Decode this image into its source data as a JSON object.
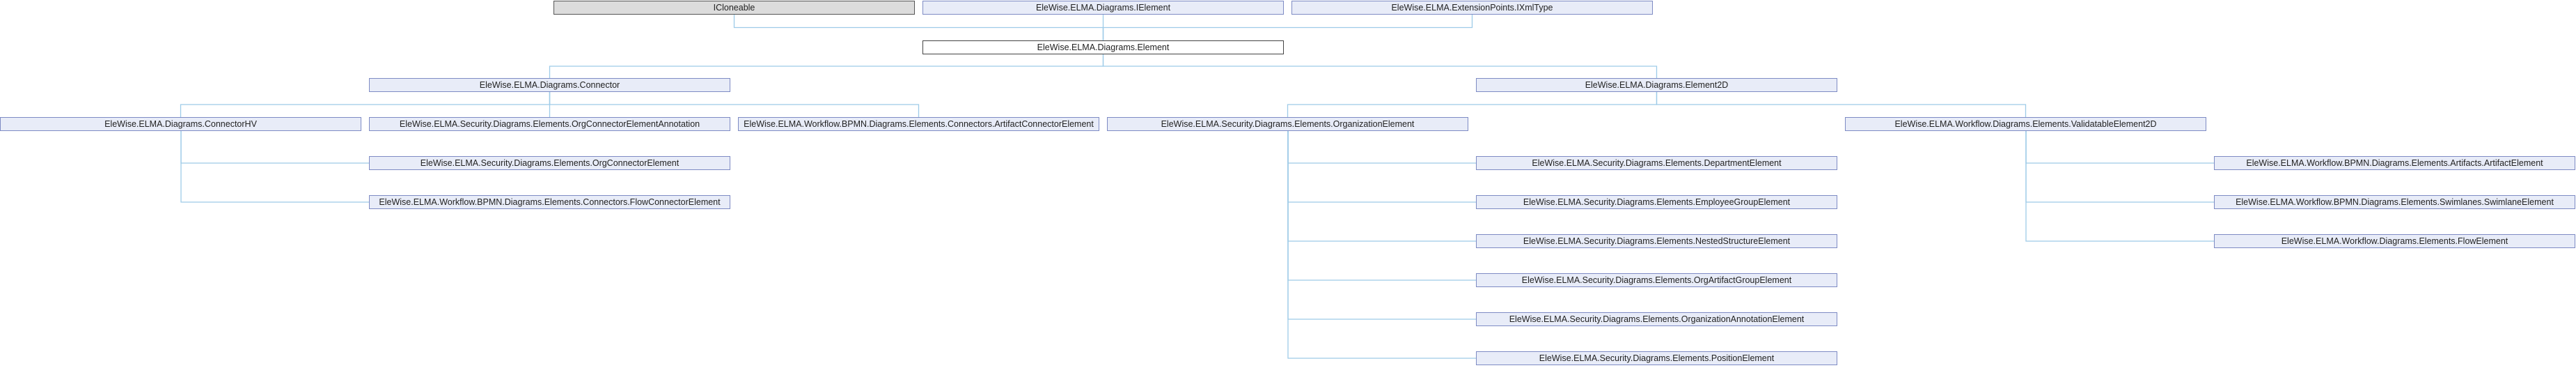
{
  "diagram": {
    "nodes": [
      {
        "id": "n_icloneable",
        "label": "ICloneable",
        "style": "grey"
      },
      {
        "id": "n_ielement",
        "label": "EleWise.ELMA.Diagrams.IElement",
        "style": "normal"
      },
      {
        "id": "n_ixmltype",
        "label": "EleWise.ELMA.ExtensionPoints.IXmlType",
        "style": "normal"
      },
      {
        "id": "n_element",
        "label": "EleWise.ELMA.Diagrams.Element",
        "style": "focus"
      },
      {
        "id": "n_connector",
        "label": "EleWise.ELMA.Diagrams.Connector",
        "style": "normal"
      },
      {
        "id": "n_element2d",
        "label": "EleWise.ELMA.Diagrams.Element2D",
        "style": "normal"
      },
      {
        "id": "n_connectorhv",
        "label": "EleWise.ELMA.Diagrams.ConnectorHV",
        "style": "normal"
      },
      {
        "id": "n_orgconnann",
        "label": "EleWise.ELMA.Security.Diagrams.Elements.OrgConnectorElementAnnotation",
        "style": "normal"
      },
      {
        "id": "n_artifactconn",
        "label": "EleWise.ELMA.Workflow.BPMN.Diagrams.Elements.Connectors.ArtifactConnectorElement",
        "style": "normal"
      },
      {
        "id": "n_orgelement",
        "label": "EleWise.ELMA.Security.Diagrams.Elements.OrganizationElement",
        "style": "normal"
      },
      {
        "id": "n_validatable",
        "label": "EleWise.ELMA.Workflow.Diagrams.Elements.ValidatableElement2D",
        "style": "normal"
      },
      {
        "id": "n_orgconn",
        "label": "EleWise.ELMA.Security.Diagrams.Elements.OrgConnectorElement",
        "style": "normal"
      },
      {
        "id": "n_flowconn",
        "label": "EleWise.ELMA.Workflow.BPMN.Diagrams.Elements.Connectors.FlowConnectorElement",
        "style": "normal"
      },
      {
        "id": "n_department",
        "label": "EleWise.ELMA.Security.Diagrams.Elements.DepartmentElement",
        "style": "normal"
      },
      {
        "id": "n_employeegroup",
        "label": "EleWise.ELMA.Security.Diagrams.Elements.EmployeeGroupElement",
        "style": "normal"
      },
      {
        "id": "n_nested",
        "label": "EleWise.ELMA.Security.Diagrams.Elements.NestedStructureElement",
        "style": "normal"
      },
      {
        "id": "n_orgartifact",
        "label": "EleWise.ELMA.Security.Diagrams.Elements.OrgArtifactGroupElement",
        "style": "normal"
      },
      {
        "id": "n_organnotation",
        "label": "EleWise.ELMA.Security.Diagrams.Elements.OrganizationAnnotationElement",
        "style": "normal"
      },
      {
        "id": "n_position",
        "label": "EleWise.ELMA.Security.Diagrams.Elements.PositionElement",
        "style": "normal"
      },
      {
        "id": "n_artifact",
        "label": "EleWise.ELMA.Workflow.BPMN.Diagrams.Elements.Artifacts.ArtifactElement",
        "style": "normal"
      },
      {
        "id": "n_swimlane",
        "label": "EleWise.ELMA.Workflow.BPMN.Diagrams.Elements.Swimlanes.SwimlaneElement",
        "style": "normal"
      },
      {
        "id": "n_flow",
        "label": "EleWise.ELMA.Workflow.Diagrams.Elements.FlowElement",
        "style": "normal"
      }
    ],
    "edges": [
      {
        "from": "n_element",
        "to": "n_icloneable"
      },
      {
        "from": "n_element",
        "to": "n_ielement"
      },
      {
        "from": "n_element",
        "to": "n_ixmltype"
      },
      {
        "from": "n_connector",
        "to": "n_element"
      },
      {
        "from": "n_element2d",
        "to": "n_element"
      },
      {
        "from": "n_connectorhv",
        "to": "n_connector"
      },
      {
        "from": "n_orgconnann",
        "to": "n_connector"
      },
      {
        "from": "n_artifactconn",
        "to": "n_connector"
      },
      {
        "from": "n_orgelement",
        "to": "n_element2d"
      },
      {
        "from": "n_validatable",
        "to": "n_element2d"
      },
      {
        "from": "n_orgconn",
        "to": "n_connectorhv"
      },
      {
        "from": "n_flowconn",
        "to": "n_connectorhv"
      },
      {
        "from": "n_department",
        "to": "n_orgelement"
      },
      {
        "from": "n_employeegroup",
        "to": "n_orgelement"
      },
      {
        "from": "n_nested",
        "to": "n_orgelement"
      },
      {
        "from": "n_orgartifact",
        "to": "n_orgelement"
      },
      {
        "from": "n_organnotation",
        "to": "n_orgelement"
      },
      {
        "from": "n_position",
        "to": "n_orgelement"
      },
      {
        "from": "n_artifact",
        "to": "n_validatable"
      },
      {
        "from": "n_swimlane",
        "to": "n_validatable"
      },
      {
        "from": "n_flow",
        "to": "n_validatable"
      }
    ]
  }
}
